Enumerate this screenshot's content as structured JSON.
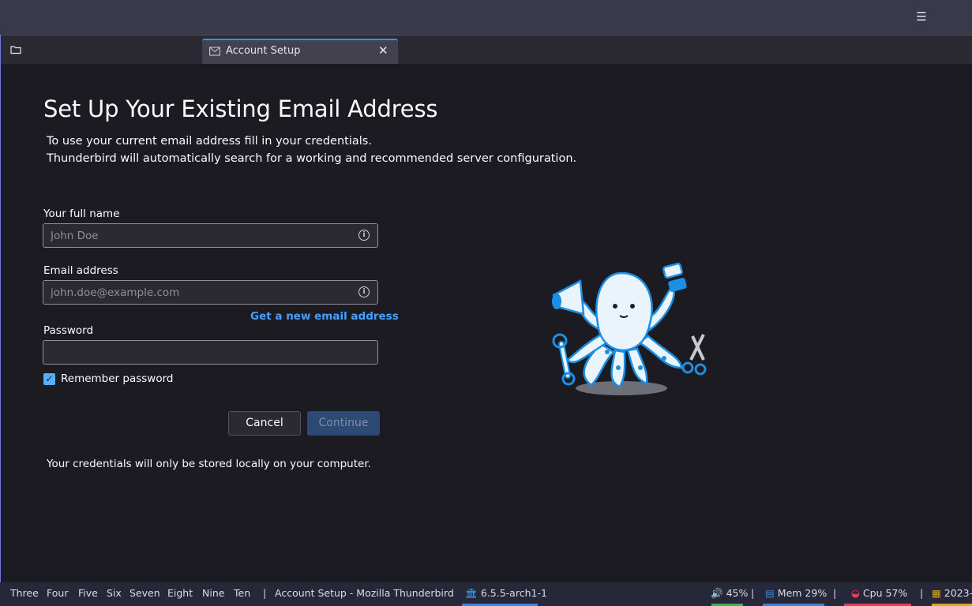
{
  "window": {
    "menu_icon": "hamburger-menu-icon"
  },
  "tabs": {
    "folder_icon": "folder-icon",
    "active": {
      "label": "Account Setup",
      "icon": "email-setup-icon",
      "close_icon": "close-icon"
    }
  },
  "setup": {
    "title": "Set Up Your Existing Email Address",
    "intro_line1": "To use your current email address fill in your credentials.",
    "intro_line2": "Thunderbird will automatically search for a working and recommended server configuration.",
    "name_label": "Your full name",
    "name_placeholder": "John Doe",
    "email_label": "Email address",
    "email_placeholder": "john.doe@example.com",
    "new_email_link": "Get a new email address",
    "password_label": "Password",
    "remember_label": "Remember password",
    "remember_checked": true,
    "cancel_label": "Cancel",
    "continue_label": "Continue",
    "footnote": "Your credentials will only be stored locally on your computer."
  },
  "statusbar": {
    "workspaces": [
      "Three",
      "Four",
      "Five",
      "Six",
      "Seven",
      "Eight",
      "Nine",
      "Ten"
    ],
    "separator": "|",
    "window_title": "Account Setup - Mozilla Thunderbird",
    "kernel": "6.5.5-arch1-1",
    "volume": "45%",
    "mem": "Mem 29%",
    "cpu": "Cpu  57%",
    "date": "2023-",
    "colors": {
      "volume": "#3fb34f",
      "mem": "#3a84d6",
      "cpu": "#e0405a",
      "date": "#d6a52a",
      "kernel": "#2f8be6"
    }
  }
}
